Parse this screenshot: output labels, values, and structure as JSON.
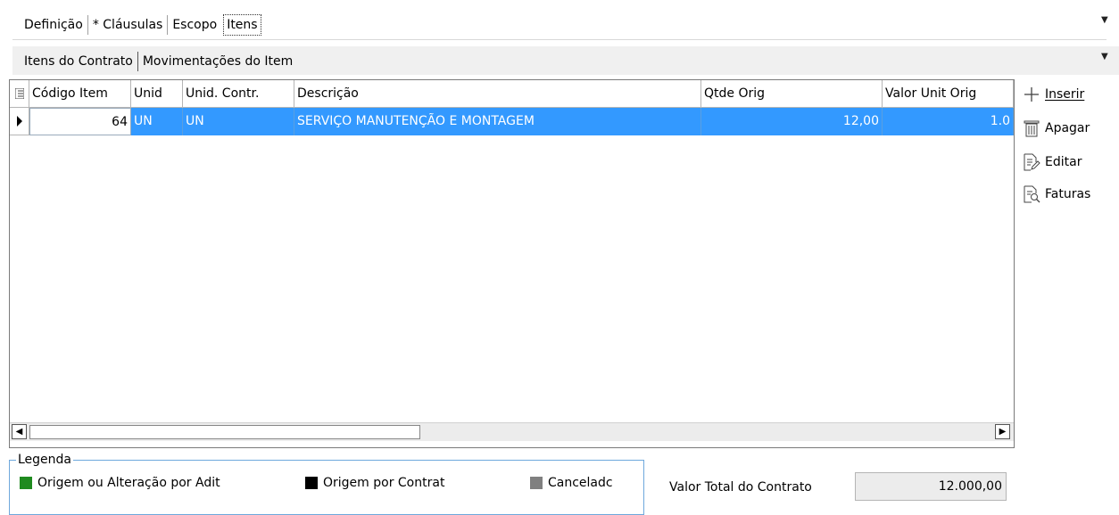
{
  "tabs_top": [
    "Definição",
    "* Cláusulas",
    "Escopo",
    "Itens"
  ],
  "tabs_top_active": "Itens",
  "tabs_sub": [
    "Itens do Contrato",
    "Movimentações do Item"
  ],
  "grid": {
    "columns": [
      "Código Item",
      "Unid",
      "Unid. Contr.",
      "Descrição",
      "Qtde Orig",
      "Valor Unit Orig"
    ],
    "rows": [
      {
        "codigo": "64",
        "unid": "UN",
        "unid_contr": "UN",
        "descricao": "SERVIÇO MANUTENÇÃO E MONTAGEM",
        "qtde": "12,00",
        "valor_unit": "1.0"
      }
    ],
    "selected_color": "#3399ff"
  },
  "actions": {
    "inserir": "Inserir",
    "apagar": "Apagar",
    "editar": "Editar",
    "faturas": "Faturas"
  },
  "legend": {
    "title": "Legenda",
    "items": [
      {
        "label": "Origem ou Alteração por Adit",
        "color": "#1f8a1f"
      },
      {
        "label": "Origem por Contrat",
        "color": "#000000"
      },
      {
        "label": "Canceladc",
        "color": "#808080"
      }
    ]
  },
  "total": {
    "label": "Valor Total do Contrato",
    "value": "12.000,00"
  },
  "icons": [
    "grid-menu-icon",
    "row-pointer-icon",
    "plus-icon",
    "trash-icon",
    "edit-icon",
    "invoice-icon",
    "scroll-left-icon",
    "scroll-right-icon",
    "dropdown-arrow-icon"
  ]
}
